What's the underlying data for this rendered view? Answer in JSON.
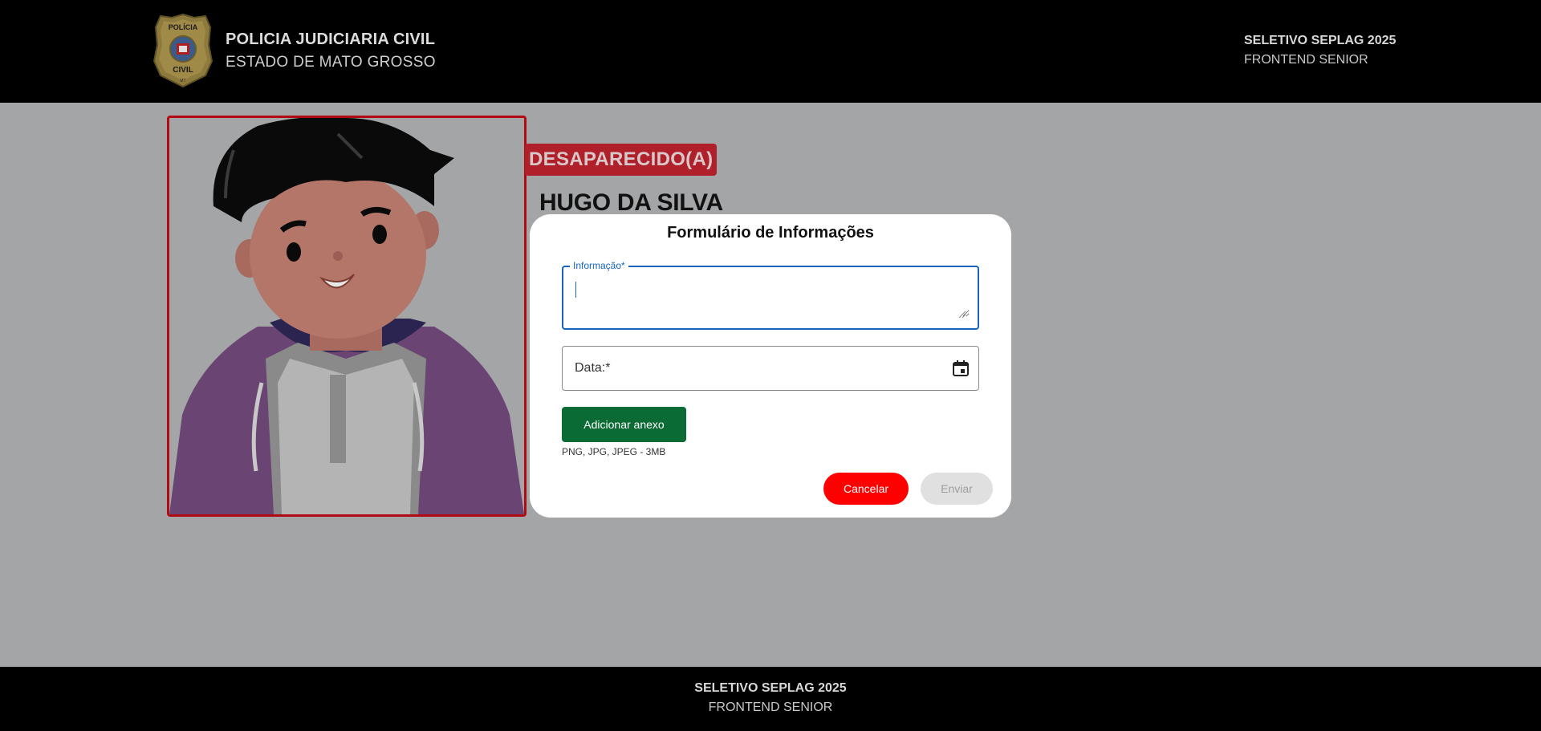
{
  "header": {
    "title": "POLICIA JUDICIARIA CIVIL",
    "subtitle": "ESTADO DE MATO GROSSO",
    "right_line1": "SELETIVO SEPLAG 2025",
    "right_line2": "FRONTEND SENIOR",
    "badge": {
      "icon": "police-badge-logo",
      "top_text": "POLÍCIA",
      "bottom_text": "CIVIL",
      "small_text": "MT"
    }
  },
  "person": {
    "status": "DESAPARECIDO(A)",
    "name": "HUGO DA SILVA",
    "photo_icon": "cartoon-person-photo"
  },
  "modal": {
    "title": "Formulário de Informações",
    "info_field": {
      "label": "Informação*",
      "value": "",
      "resize_icon": "resize-handle-icon"
    },
    "date_field": {
      "label": "Data:*",
      "icon": "calendar-icon"
    },
    "attach_button": "Adicionar anexo",
    "attach_hint": "PNG, JPG, JPEG - 3MB",
    "cancel_button": "Cancelar",
    "send_button": "Enviar"
  },
  "footer": {
    "line1": "SELETIVO SEPLAG 2025",
    "line2": "FRONTEND SENIOR"
  },
  "colors": {
    "overlay_bg": "#a4a5a7",
    "header_bg": "#000000",
    "accent_red": "#b00a14",
    "focus_blue": "#1565c0",
    "attach_green": "#0b6b34",
    "cancel_red": "#ff0000"
  }
}
